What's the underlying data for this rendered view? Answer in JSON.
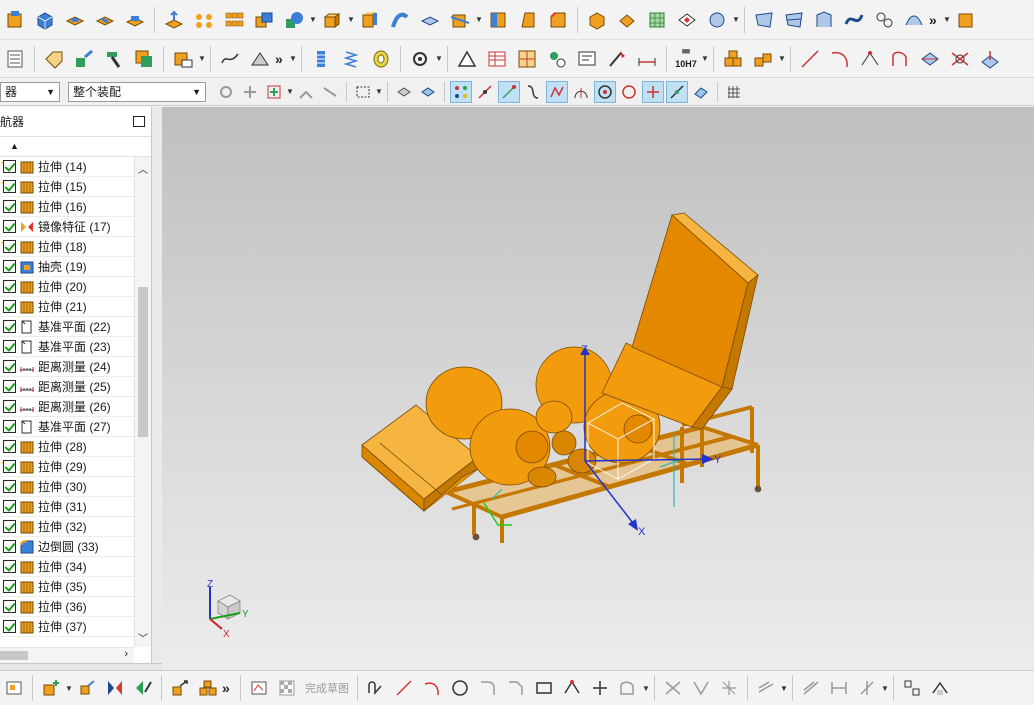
{
  "selection": {
    "filter_value": "器",
    "assembly_scope_value": "整个装配"
  },
  "navigator": {
    "title": "航器",
    "items": [
      {
        "label": "拉伸 (14)",
        "icon": "extrude-icon",
        "rollback": true
      },
      {
        "label": "拉伸 (15)",
        "icon": "extrude-icon",
        "rollback": true
      },
      {
        "label": "拉伸 (16)",
        "icon": "extrude-icon",
        "rollback": false
      },
      {
        "label": "镜像特征 (17)",
        "icon": "mirror-feature-icon",
        "rollback": false
      },
      {
        "label": "拉伸 (18)",
        "icon": "extrude-icon",
        "rollback": true
      },
      {
        "label": "抽壳 (19)",
        "icon": "shell-icon",
        "rollback": false
      },
      {
        "label": "拉伸 (20)",
        "icon": "extrude-icon",
        "rollback": false
      },
      {
        "label": "拉伸 (21)",
        "icon": "extrude-icon",
        "rollback": false
      },
      {
        "label": "基准平面 (22)",
        "icon": "datum-plane-icon",
        "rollback": false
      },
      {
        "label": "基准平面 (23)",
        "icon": "datum-plane-icon",
        "rollback": false
      },
      {
        "label": "距离测量 (24)",
        "icon": "distance-measure-icon",
        "rollback": false
      },
      {
        "label": "距离测量 (25)",
        "icon": "distance-measure-icon",
        "rollback": false
      },
      {
        "label": "距离测量 (26)",
        "icon": "distance-measure-icon",
        "rollback": false
      },
      {
        "label": "基准平面 (27)",
        "icon": "datum-plane-icon",
        "rollback": false
      },
      {
        "label": "拉伸 (28)",
        "icon": "extrude-icon",
        "rollback": false
      },
      {
        "label": "拉伸 (29)",
        "icon": "extrude-icon",
        "rollback": true
      },
      {
        "label": "拉伸 (30)",
        "icon": "extrude-icon",
        "rollback": false
      },
      {
        "label": "拉伸 (31)",
        "icon": "extrude-icon",
        "rollback": false
      },
      {
        "label": "拉伸 (32)",
        "icon": "extrude-icon",
        "rollback": false
      },
      {
        "label": "边倒圆 (33)",
        "icon": "edge-blend-icon",
        "rollback": false
      },
      {
        "label": "拉伸 (34)",
        "icon": "extrude-icon",
        "rollback": false
      },
      {
        "label": "拉伸 (35)",
        "icon": "extrude-icon",
        "rollback": false
      },
      {
        "label": "拉伸 (36)",
        "icon": "extrude-icon",
        "rollback": false
      },
      {
        "label": "拉伸 (37)",
        "icon": "extrude-icon",
        "rollback": false
      }
    ]
  },
  "viewport": {
    "model_color": "#f29b0c",
    "axis_labels": {
      "x": "X",
      "y": "Y",
      "z": "Z"
    },
    "triad_labels": {
      "x": "X",
      "y": "Y",
      "z": "Z"
    }
  },
  "sketch_toolbar": {
    "finish_sketch_label": "完成草图"
  },
  "part_label": {
    "value": "10H7"
  },
  "colors": {
    "accent": "#f29b0c",
    "check": "#1a9a1a",
    "axis_x": "#2233cc",
    "axis_y": "#2233cc",
    "axis_z": "#2233cc"
  }
}
